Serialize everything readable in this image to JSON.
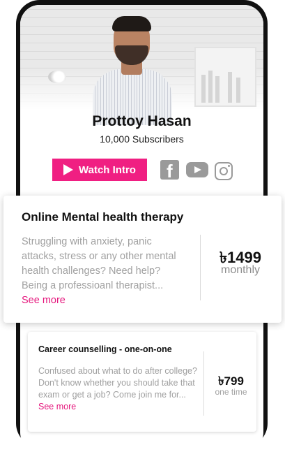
{
  "profile": {
    "name": "Prottoy Hasan",
    "subscribers": "10,000 Subscribers",
    "watch_intro_label": "Watch Intro"
  },
  "social": {
    "icons": [
      "facebook-icon",
      "youtube-icon",
      "instagram-icon"
    ]
  },
  "services": [
    {
      "title": "Online Mental health therapy",
      "description": "Struggling with anxiety, panic attacks, stress or any other mental health challenges? Need help? Being a professioanl therapist...",
      "see_more": "See more",
      "price": "৳1499",
      "period": "monthly"
    },
    {
      "title": "Career counselling - one-on-one",
      "description": "Confused about what to do after college? Don't know whether you should take that exam or get a job? Come join me for...",
      "see_more": "See more",
      "price": "৳799",
      "period": "one time"
    }
  ],
  "colors": {
    "accent": "#f01f82",
    "muted": "#a0a0a0",
    "frame": "#111111"
  }
}
